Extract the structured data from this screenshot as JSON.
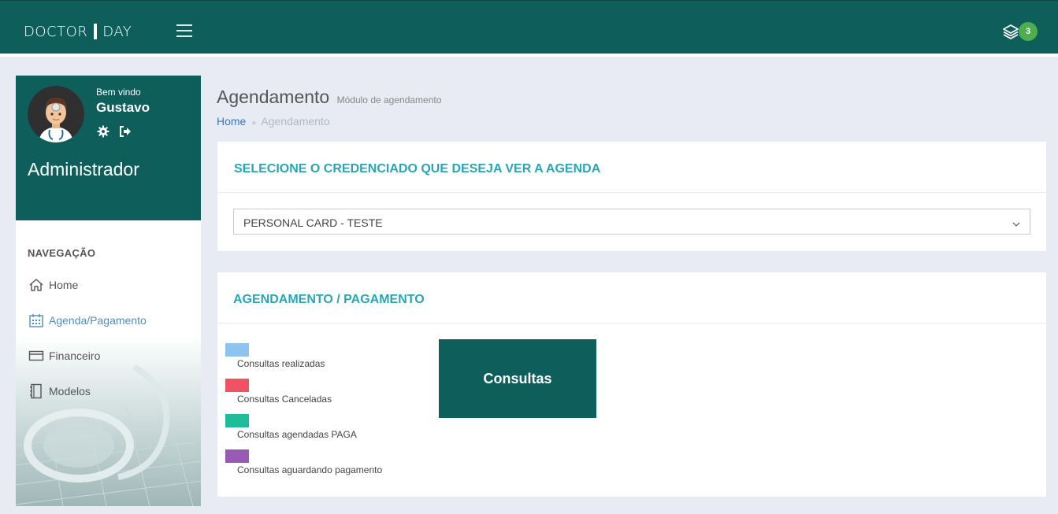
{
  "app": {
    "logo_left": "DOCTOR",
    "logo_right": "DAY",
    "notifications_count": "3",
    "brand_color": "#0e5e5c",
    "accent_color": "#27a7b4"
  },
  "profile": {
    "welcome": "Bem vindo",
    "name": "Gustavo",
    "role": "Administrador"
  },
  "navigation": {
    "title": "NAVEGAÇÃO",
    "items": [
      {
        "label": "Home",
        "icon": "home-icon"
      },
      {
        "label": "Agenda/Pagamento",
        "icon": "calendar-icon"
      },
      {
        "label": "Financeiro",
        "icon": "credit-card-icon"
      },
      {
        "label": "Modelos",
        "icon": "notebook-icon"
      }
    ]
  },
  "page": {
    "title": "Agendamento",
    "subtitle": "Módulo de agendamento",
    "breadcrumb": {
      "home": "Home",
      "current": "Agendamento"
    }
  },
  "credenciado_panel": {
    "title": "SELECIONE O CREDENCIADO QUE DESEJA VER A AGENDA",
    "selected_value": "PERSONAL CARD - TESTE"
  },
  "agendamento_panel": {
    "title": "AGENDAMENTO / PAGAMENTO",
    "legend": [
      {
        "label": "Consultas realizadas",
        "color": "#8ec3f0"
      },
      {
        "label": "Consultas Canceladas",
        "color": "#ef5260"
      },
      {
        "label": "Consultas agendadas PAGA",
        "color": "#1fbc9c"
      },
      {
        "label": "Consultas aguardando pagamento",
        "color": "#9b59b6"
      }
    ],
    "button_label": "Consultas"
  }
}
